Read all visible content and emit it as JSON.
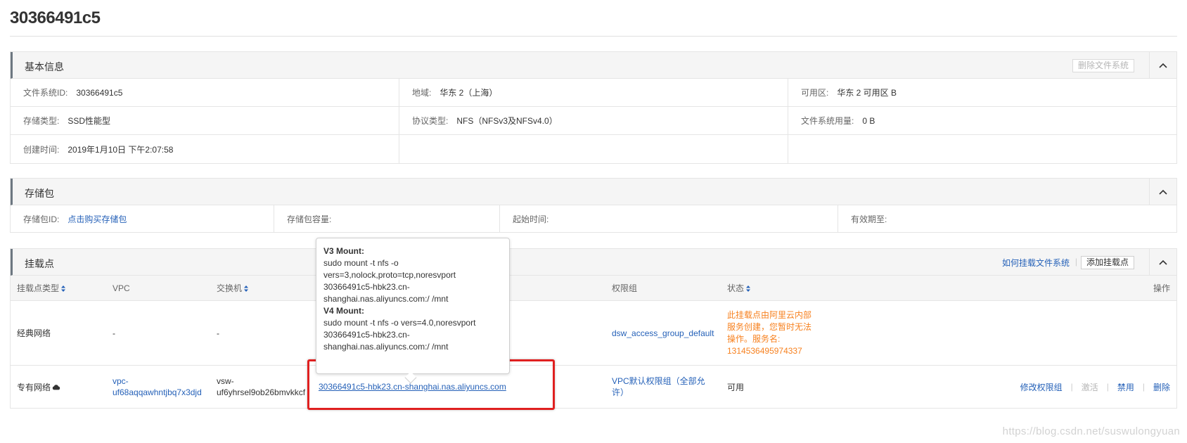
{
  "page_title": "30366491c5",
  "basic_info": {
    "title": "基本信息",
    "delete_button": "删除文件系统",
    "rows": [
      [
        {
          "label": "文件系统ID:",
          "value": "30366491c5"
        },
        {
          "label": "地域:",
          "value": "华东 2（上海）"
        },
        {
          "label": "可用区:",
          "value": "华东 2 可用区 B"
        }
      ],
      [
        {
          "label": "存储类型:",
          "value": "SSD性能型"
        },
        {
          "label": "协议类型:",
          "value": "NFS（NFSv3及NFSv4.0）"
        },
        {
          "label": "文件系统用量:",
          "value": "0 B"
        }
      ],
      [
        {
          "label": "创建时间:",
          "value": "2019年1月10日 下午2:07:58"
        }
      ]
    ]
  },
  "storage_package": {
    "title": "存储包",
    "id_label": "存储包ID:",
    "id_link": "点击购买存储包",
    "capacity_label": "存储包容量:",
    "start_label": "起始时间:",
    "expiry_label": "有效期至:"
  },
  "mount_points": {
    "title": "挂载点",
    "how_to_link": "如何挂载文件系统",
    "add_button": "添加挂载点",
    "columns": {
      "type": "挂载点类型",
      "vpc": "VPC",
      "vswitch": "交换机",
      "permission": "权限组",
      "status": "状态",
      "actions": "操作"
    },
    "rows": [
      {
        "type": "经典网络",
        "vpc": "-",
        "vswitch": "-",
        "permission": "dsw_access_group_default",
        "status_lines": [
          "此挂载点由阿里云内部",
          "服务创建，您暂时无法",
          "操作。服务名:",
          "1314536495974337"
        ]
      },
      {
        "type": "专有网络",
        "vpc_lines": [
          "vpc-",
          "uf68aqqawhntjbq7x3djd"
        ],
        "vswitch_lines": [
          "vsw-",
          "uf6yhrsel9ob26bmvkkcf"
        ],
        "address": "30366491c5-hbk23.cn-shanghai.nas.aliyuncs.com",
        "permission_lines": [
          "VPC默认权限组（全部允",
          "许）"
        ],
        "status": "可用",
        "actions": {
          "modify": "修改权限组",
          "activate": "激活",
          "disable": "禁用",
          "delete": "删除"
        }
      }
    ]
  },
  "tooltip": {
    "v3_title": "V3 Mount:",
    "v3_lines": [
      "sudo mount -t nfs -o",
      "vers=3,nolock,proto=tcp,noresvport",
      "30366491c5-hbk23.cn-",
      "shanghai.nas.aliyuncs.com:/ /mnt"
    ],
    "v4_title": "V4 Mount:",
    "v4_lines": [
      "sudo mount -t nfs -o vers=4.0,noresvport",
      "30366491c5-hbk23.cn-",
      "shanghai.nas.aliyuncs.com:/ /mnt"
    ]
  },
  "watermark": "https://blog.csdn.net/suswulongyuan",
  "colors": {
    "link": "#2561b8",
    "warning": "#f7811f",
    "highlight": "#e02020"
  }
}
